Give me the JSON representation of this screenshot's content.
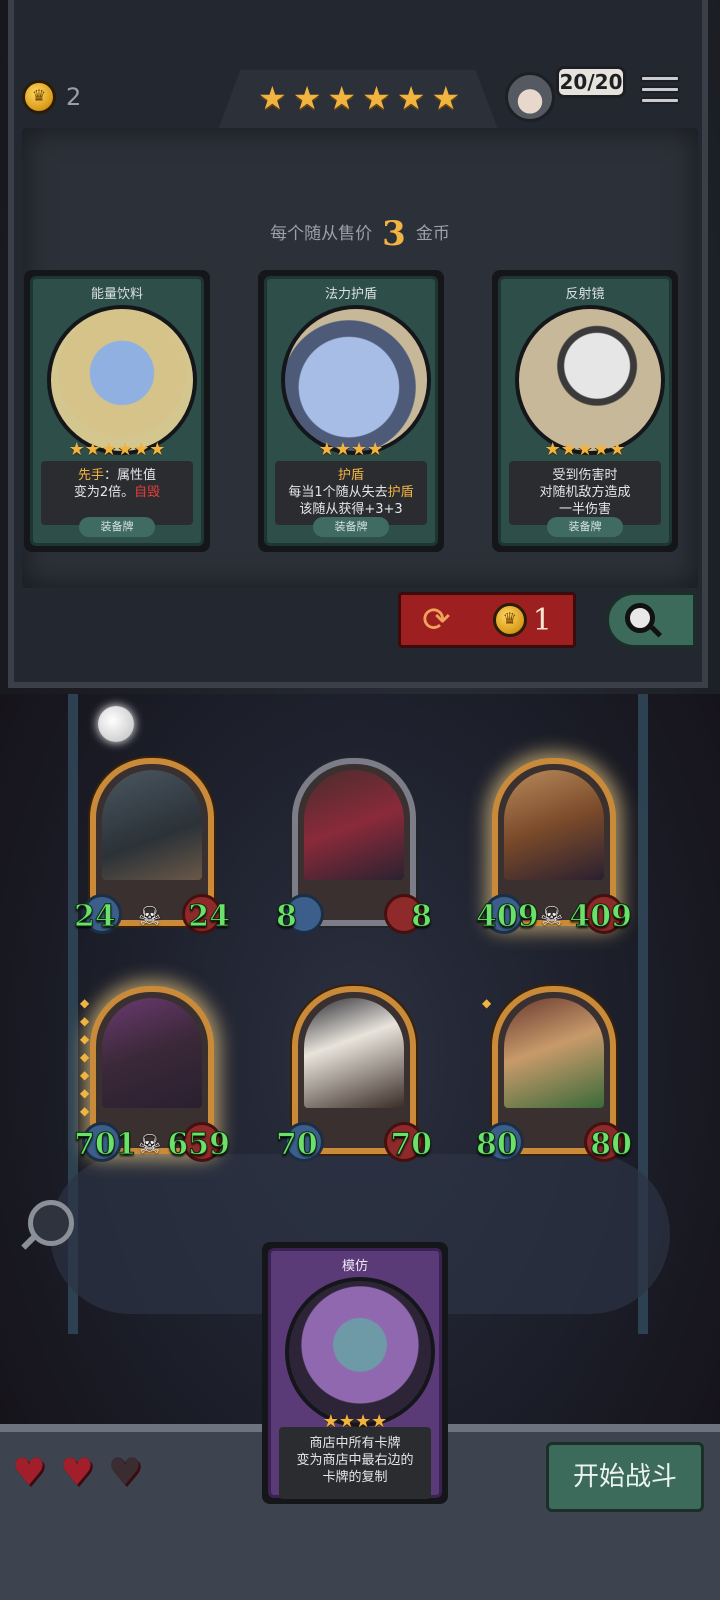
{
  "header": {
    "gold": "2",
    "star_count": 6,
    "health_display": "20/20",
    "icons": [
      "crown-coin-icon",
      "menu-icon",
      "avatar-icon"
    ]
  },
  "shop": {
    "price_prefix": "每个随从售价",
    "price_value": "3",
    "price_suffix": "金币",
    "cards": [
      {
        "name": "能量饮料",
        "stars": 6,
        "desc_html": [
          {
            "text": "先手",
            "style": "hl"
          },
          {
            "text": "：属性值",
            "style": ""
          },
          {
            "text": "\n变为2倍。",
            "style": ""
          },
          {
            "text": "自毁",
            "style": "red"
          }
        ],
        "type": "装备牌"
      },
      {
        "name": "法力护盾",
        "stars": 4,
        "desc_html": [
          {
            "text": "护盾",
            "style": "hl"
          },
          {
            "text": "\n每当1个随从失去",
            "style": ""
          },
          {
            "text": "护盾",
            "style": "hl"
          },
          {
            "text": "\n该随从获得+3+3",
            "style": ""
          }
        ],
        "type": "装备牌"
      },
      {
        "name": "反射镜",
        "stars": 5,
        "desc_html": [
          {
            "text": "受到伤害时\n对随机敌方造成\n一半伤害",
            "style": ""
          }
        ],
        "type": "装备牌"
      }
    ],
    "refresh_cost": "1"
  },
  "board": {
    "minions": [
      {
        "atk": "24",
        "hp": "24",
        "frame": "gold",
        "skull": true,
        "glow": false,
        "diamonds": 0
      },
      {
        "atk": "8",
        "hp": "8",
        "frame": "silver",
        "skull": false,
        "glow": false,
        "diamonds": 0
      },
      {
        "atk": "409",
        "hp": "409",
        "frame": "gold",
        "skull": true,
        "glow": true,
        "diamonds": 0
      },
      {
        "atk": "701",
        "hp": "659",
        "frame": "gold",
        "skull": true,
        "glow": true,
        "diamonds": 7
      },
      {
        "atk": "70",
        "hp": "70",
        "frame": "gold",
        "skull": false,
        "glow": false,
        "diamonds": 0
      },
      {
        "atk": "80",
        "hp": "80",
        "frame": "gold",
        "skull": false,
        "glow": false,
        "diamonds": 1
      }
    ],
    "held_card": {
      "name": "模仿",
      "stars": 4,
      "desc": "商店中所有卡牌\n变为商店中最右边的\n卡牌的复制"
    }
  },
  "footer": {
    "lives_full": 2,
    "lives_total": 3,
    "start_label": "开始战斗"
  },
  "colors": {
    "gold": "#f2b441",
    "shop_card_green": "#2e4e49",
    "held_card_purple": "#5b3a78",
    "refresh_red": "#9e1f1f",
    "stat_green": "#6be06b"
  }
}
